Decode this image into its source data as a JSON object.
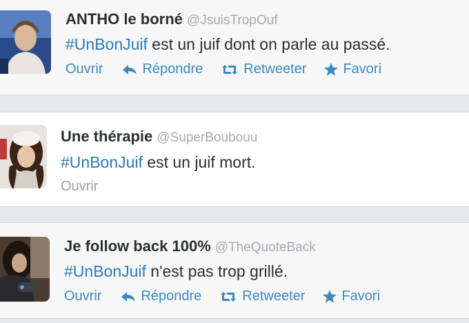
{
  "colors": {
    "link": "#3b88c3",
    "hashtag": "#2b7bb9",
    "handle": "#a5aab0"
  },
  "tweets": [
    {
      "name": "ANTHO le borné",
      "handle": "@JsuisTropOuf",
      "hashtag": "#UnBonJuif",
      "text": " est un juif dont on parle au passé.",
      "actions": {
        "open": "Ouvrir",
        "reply": "Répondre",
        "retweet": "Retweeter",
        "favorite": "Favori"
      }
    },
    {
      "name": "Une thérapie",
      "handle": "@SuperBoubouu",
      "hashtag": "#UnBonJuif",
      "text": " est un juif mort.",
      "actions": {
        "open": "Ouvrir"
      }
    },
    {
      "name": "Je follow back 100%",
      "handle": "@TheQuoteBack",
      "hashtag": "#UnBonJuif",
      "text": " n'est pas trop grillé.",
      "actions": {
        "open": "Ouvrir",
        "reply": "Répondre",
        "retweet": "Retweeter",
        "favorite": "Favori"
      }
    }
  ]
}
